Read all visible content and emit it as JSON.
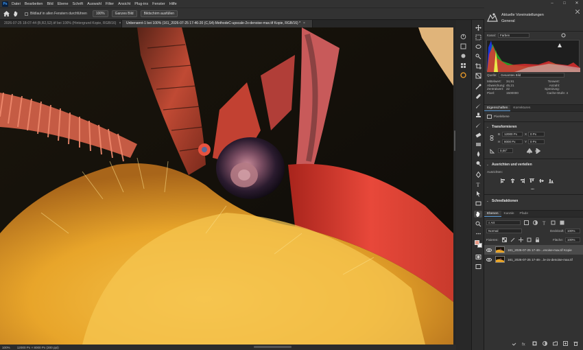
{
  "menubar": {
    "items": [
      "Datei",
      "Bearbeiten",
      "Bild",
      "Ebene",
      "Schrift",
      "Auswahl",
      "Filter",
      "Ansicht",
      "Plug-ins",
      "Fenster",
      "Hilfe"
    ],
    "logo": "Ps"
  },
  "optionsbar": {
    "scroll_all_label": "Bildlauf in allen Fenstern durchführen",
    "zoom_btn": "100%",
    "fit_btn": "Ganzes Bild",
    "fill_btn": "Bildschirm ausfüllen"
  },
  "tabs": [
    {
      "label": "2026-07-25 18-07-44 (B,R2,S2).tif bei 100% (Hintergrund Kopie, RGB/16)",
      "close": "×",
      "active": false
    },
    {
      "label": "Unbenannt-1 bei 100% (161_2026-07-25 17-46-20 (C,S4)-MethodeC-upscale-2x-denoise-max.tif Kopie, RGB/16) *",
      "close": "×",
      "active": true
    }
  ],
  "statusbar": {
    "zoom": "100%",
    "doc_info": "12000 Px × 8000 Px (300 ppi)"
  },
  "learn_panel": {
    "title": "Aktuelle Voreinstellungen",
    "subtitle": "General"
  },
  "histogram": {
    "channel_label": "Kanal:",
    "channel_value": "Farben",
    "source_label": "Quelle:",
    "source_value": "Gesamtes Bild",
    "stats_left": [
      {
        "k": "Mittelwert:",
        "v": "34,91"
      },
      {
        "k": "Abweichung:",
        "v": "45,21"
      },
      {
        "k": "Zentralwert:",
        "v": "22"
      },
      {
        "k": "Pixel:",
        "v": "1500000"
      }
    ],
    "stats_right": [
      {
        "k": "Tonwert:",
        "v": ""
      },
      {
        "k": "Anzahl:",
        "v": ""
      },
      {
        "k": "Spreizung:",
        "v": ""
      },
      {
        "k": "Cache-Stufe:",
        "v": "4"
      }
    ]
  },
  "properties": {
    "tabs": [
      "Eigenschaften",
      "Korrekturen"
    ],
    "layer_type": "Pixelebene",
    "transform_title": "Transformieren",
    "w_label": "B",
    "w_value": "12000 Px",
    "x_label": "X",
    "x_value": "0 Px",
    "h_label": "H",
    "h_value": "8000 Px",
    "y_label": "Y",
    "y_value": "0 Px",
    "angle_value": "0,00°",
    "align_title": "Ausrichten und verteilen",
    "align_sub": "Ausrichten:",
    "more": "•••",
    "quick_title": "Schnellaktionen"
  },
  "layers": {
    "tabs": [
      "Ebenen",
      "Kanäle",
      "Pfade"
    ],
    "filter_kind": "Art",
    "blend_mode": "Normal",
    "opacity_label": "Deckkraft:",
    "opacity_value": "100%",
    "lock_label": "Fixieren:",
    "fill_label": "Fläche:",
    "fill_value": "100%",
    "items": [
      {
        "name": "161_2026-07-25 17-46-...enoise-max.tif Kopie",
        "selected": true
      },
      {
        "name": "161_2026-07-25 17-46-...le-2x-denoise-max.tif",
        "selected": false
      }
    ]
  },
  "colors": {
    "accent": "#5b9bd5",
    "fg_swatch": "#e89a86",
    "bg_swatch": "#f2f2f2"
  }
}
